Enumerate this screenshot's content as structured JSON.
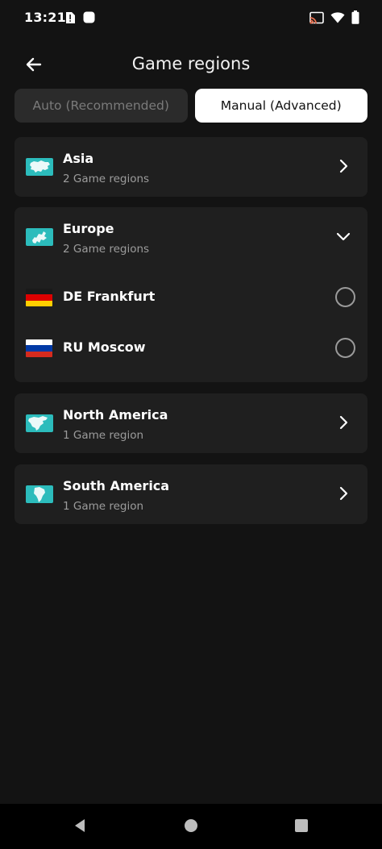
{
  "status_bar": {
    "time": "13:21",
    "left_icons": [
      "alert-card-icon",
      "notification-square-icon"
    ],
    "right_icons": [
      "cast-icon",
      "wifi-icon",
      "battery-icon"
    ]
  },
  "header": {
    "title": "Game regions",
    "back_icon": "arrow-left-icon"
  },
  "mode_tabs": {
    "auto_label": "Auto (Recommended)",
    "manual_label": "Manual (Advanced)",
    "selected": "manual"
  },
  "regions": [
    {
      "name": "Asia",
      "count": "2 Game regions",
      "expanded": false,
      "icon": "asia-map-icon"
    },
    {
      "name": "Europe",
      "count": "2 Game regions",
      "expanded": true,
      "icon": "europe-map-icon",
      "servers": [
        {
          "name": "DE Frankfurt",
          "flag": "germany-flag",
          "selected": false
        },
        {
          "name": "RU Moscow",
          "flag": "russia-flag",
          "selected": false
        }
      ]
    },
    {
      "name": "North America",
      "count": "1 Game region",
      "expanded": false,
      "icon": "north-america-map-icon"
    },
    {
      "name": "South America",
      "count": "1 Game region",
      "expanded": false,
      "icon": "south-america-map-icon"
    }
  ],
  "colors": {
    "background": "#131313",
    "card": "#1f1f1f",
    "accent_teal": "#2cbcbc",
    "active_tab": "#ffffff",
    "inactive_tab": "#2b2b2b"
  },
  "nav_bar": {
    "buttons": [
      "back-triangle-icon",
      "home-circle-icon",
      "recents-square-icon"
    ]
  }
}
